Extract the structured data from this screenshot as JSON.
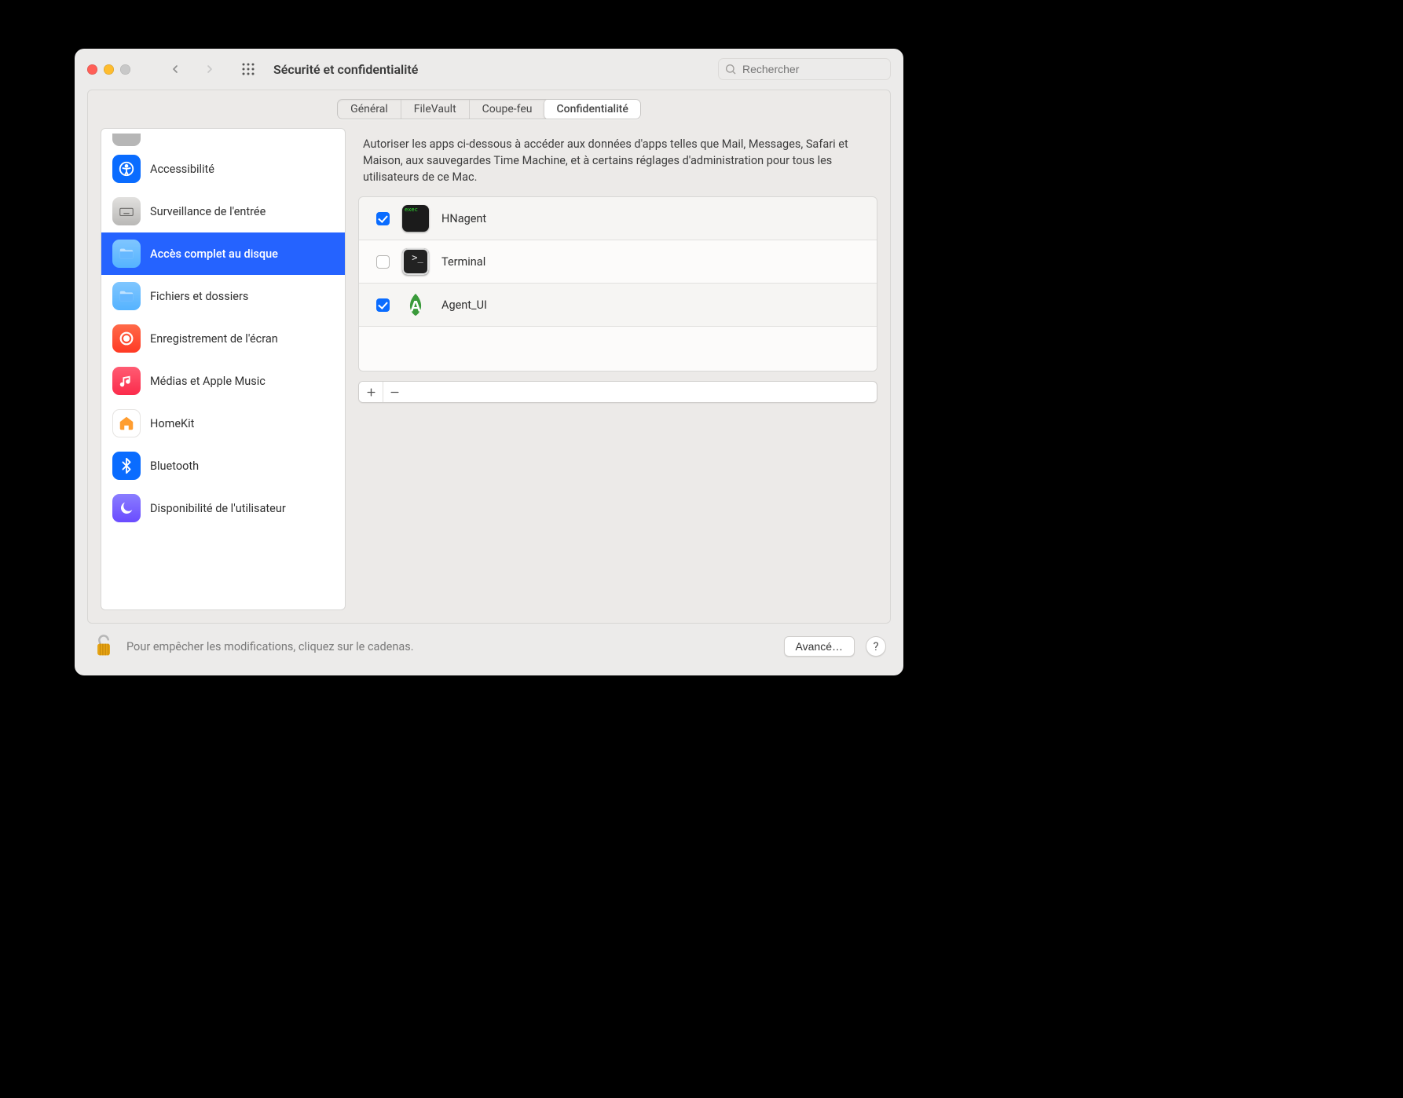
{
  "window": {
    "title": "Sécurité et confidentialité",
    "search_placeholder": "Rechercher"
  },
  "tabs": {
    "general": "Général",
    "filevault": "FileVault",
    "firewall": "Coupe-feu",
    "privacy": "Confidentialité"
  },
  "sidebar": {
    "items": [
      {
        "key": "accessibility",
        "label": "Accessibilité",
        "icon": "accessibility",
        "bg": "bg-blue"
      },
      {
        "key": "input-monitoring",
        "label": "Surveillance de l'entrée",
        "icon": "keyboard",
        "bg": "bg-key"
      },
      {
        "key": "full-disk-access",
        "label": "Accès complet au disque",
        "icon": "folder",
        "bg": "bg-folder",
        "selected": true
      },
      {
        "key": "files-folders",
        "label": "Fichiers et dossiers",
        "icon": "folder",
        "bg": "bg-folder"
      },
      {
        "key": "screen-recording",
        "label": "Enregistrement de l'écran",
        "icon": "record",
        "bg": "bg-orange"
      },
      {
        "key": "media-apple-music",
        "label": "Médias et Apple Music",
        "icon": "music",
        "bg": "bg-red"
      },
      {
        "key": "homekit",
        "label": "HomeKit",
        "icon": "home",
        "bg": "bg-home"
      },
      {
        "key": "bluetooth",
        "label": "Bluetooth",
        "icon": "bluetooth",
        "bg": "bg-blue"
      },
      {
        "key": "focus",
        "label": "Disponibilité de l'utilisateur",
        "icon": "moon",
        "bg": "bg-purple"
      }
    ]
  },
  "description": "Autoriser les apps ci-dessous à accéder aux données d'apps telles que Mail, Messages, Safari et Maison, aux sauvegardes Time Machine, et à certains réglages d'administration pour tous les utilisateurs de ce Mac.",
  "apps": [
    {
      "name": "HNagent",
      "checked": true,
      "icon": "terminal-exec"
    },
    {
      "name": "Terminal",
      "checked": false,
      "icon": "terminal"
    },
    {
      "name": "Agent_UI",
      "checked": true,
      "icon": "agent-a"
    }
  ],
  "footer": {
    "lock_msg": "Pour empêcher les modifications, cliquez sur le cadenas.",
    "advanced": "Avancé…"
  }
}
